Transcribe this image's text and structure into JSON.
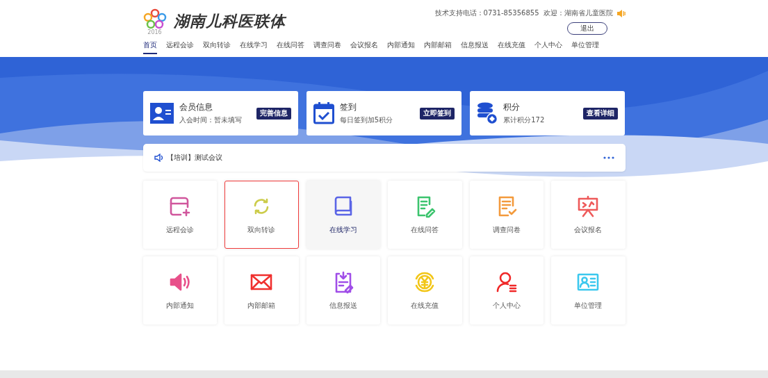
{
  "header": {
    "logo_year": "2016",
    "title": "湖南儿科医联体",
    "support": "技术支持电话：0731-85356855",
    "welcome": "欢迎：湖南省儿童医院",
    "logout": "退出"
  },
  "nav": [
    {
      "label": "首页",
      "selected": true
    },
    {
      "label": "远程会诊",
      "selected": false
    },
    {
      "label": "双向转诊",
      "selected": false
    },
    {
      "label": "在线学习",
      "selected": false
    },
    {
      "label": "在线问答",
      "selected": false
    },
    {
      "label": "调查问卷",
      "selected": false
    },
    {
      "label": "会议报名",
      "selected": false
    },
    {
      "label": "内部通知",
      "selected": false
    },
    {
      "label": "内部邮箱",
      "selected": false
    },
    {
      "label": "信息报送",
      "selected": false
    },
    {
      "label": "在线充值",
      "selected": false
    },
    {
      "label": "个人中心",
      "selected": false
    },
    {
      "label": "单位管理",
      "selected": false
    }
  ],
  "cards": [
    {
      "kind": "member",
      "title": "会员信息",
      "subtitle": "入会时间：暂未填写",
      "button": "完善信息"
    },
    {
      "kind": "signin",
      "title": "签到",
      "subtitle": "每日签到加5积分",
      "button": "立即签到"
    },
    {
      "kind": "points",
      "title": "积分",
      "subtitle": "累计积分172",
      "button": "查看详细"
    }
  ],
  "notice": {
    "text": "【培训】测试会议"
  },
  "tiles": [
    {
      "kind": "consult",
      "label": "远程会诊",
      "color": "#d0569c",
      "hovered": false,
      "outlined": false
    },
    {
      "kind": "refer",
      "label": "双向转诊",
      "color": "#cccc4a",
      "hovered": false,
      "outlined": true
    },
    {
      "kind": "book",
      "label": "在线学习",
      "color": "#5a64e6",
      "hovered": true,
      "outlined": false
    },
    {
      "kind": "answer",
      "label": "在线问答",
      "color": "#3cc46e",
      "hovered": false,
      "outlined": false
    },
    {
      "kind": "survey",
      "label": "调查问卷",
      "color": "#f39a3c",
      "hovered": false,
      "outlined": false
    },
    {
      "kind": "meeting",
      "label": "会议报名",
      "color": "#ee5a5a",
      "hovered": false,
      "outlined": false
    },
    {
      "kind": "notify",
      "label": "内部通知",
      "color": "#e8508a",
      "hovered": false,
      "outlined": false
    },
    {
      "kind": "mail",
      "label": "内部邮箱",
      "color": "#f0302e",
      "hovered": false,
      "outlined": false
    },
    {
      "kind": "report",
      "label": "信息报送",
      "color": "#a04ee8",
      "hovered": false,
      "outlined": false
    },
    {
      "kind": "recharge",
      "label": "在线充值",
      "color": "#f2c618",
      "hovered": false,
      "outlined": false
    },
    {
      "kind": "person",
      "label": "个人中心",
      "color": "#f02828",
      "hovered": false,
      "outlined": false
    },
    {
      "kind": "unit",
      "label": "单位管理",
      "color": "#3cc8ee",
      "hovered": false,
      "outlined": false
    }
  ]
}
